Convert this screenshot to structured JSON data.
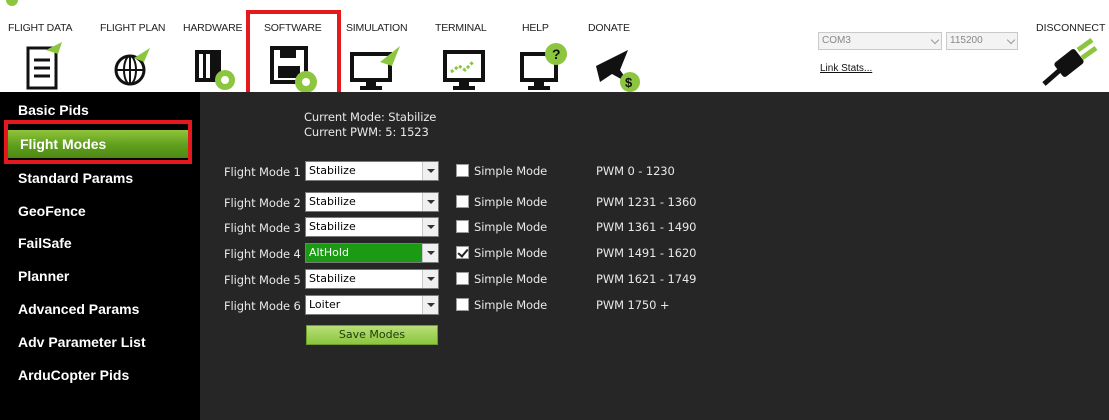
{
  "nav": {
    "items": [
      {
        "label": "FLIGHT DATA"
      },
      {
        "label": "FLIGHT PLAN"
      },
      {
        "label": "HARDWARE"
      },
      {
        "label": "SOFTWARE"
      },
      {
        "label": "SIMULATION"
      },
      {
        "label": "TERMINAL"
      },
      {
        "label": "HELP"
      },
      {
        "label": "DONATE"
      }
    ],
    "icons": [
      "flight-data-icon",
      "flight-plan-icon",
      "hardware-icon",
      "software-icon",
      "simulation-icon",
      "terminal-icon",
      "help-icon",
      "donate-icon"
    ]
  },
  "connection": {
    "port": "COM3",
    "baud": "115200",
    "link_stats": "Link Stats...",
    "disconnect_label": "DISCONNECT"
  },
  "sidebar": {
    "items": [
      {
        "label": "Basic Pids"
      },
      {
        "label": "Flight Modes"
      },
      {
        "label": "Standard Params"
      },
      {
        "label": "GeoFence"
      },
      {
        "label": "FailSafe"
      },
      {
        "label": "Planner"
      },
      {
        "label": "Advanced Params"
      },
      {
        "label": "Adv Parameter List"
      },
      {
        "label": "ArduCopter Pids"
      }
    ]
  },
  "status": {
    "current_mode": "Current Mode:  Stabilize",
    "current_pwm": "Current PWM:   5: 1523"
  },
  "modes": [
    {
      "label": "Flight Mode 1",
      "value": "Stabilize",
      "simple_label": "Simple Mode",
      "simple": false,
      "pwm": "PWM 0 - 1230"
    },
    {
      "label": "Flight Mode 2",
      "value": "Stabilize",
      "simple_label": "Simple Mode",
      "simple": false,
      "pwm": "PWM 1231 - 1360"
    },
    {
      "label": "Flight Mode 3",
      "value": "Stabilize",
      "simple_label": "Simple Mode",
      "simple": false,
      "pwm": "PWM 1361 - 1490"
    },
    {
      "label": "Flight Mode 4",
      "value": "AltHold",
      "simple_label": "Simple Mode",
      "simple": true,
      "pwm": "PWM 1491 - 1620"
    },
    {
      "label": "Flight Mode 5",
      "value": "Stabilize",
      "simple_label": "Simple Mode",
      "simple": false,
      "pwm": "PWM 1621 - 1749"
    },
    {
      "label": "Flight Mode 6",
      "value": "Loiter",
      "simple_label": "Simple Mode",
      "simple": false,
      "pwm": "PWM 1750 +"
    }
  ],
  "save_label": "Save Modes",
  "colors": {
    "highlight": "#e3191e",
    "active_mode": "#1b9a14",
    "sidebar_active": "#6aa624",
    "icon_green": "#8cc63f"
  }
}
